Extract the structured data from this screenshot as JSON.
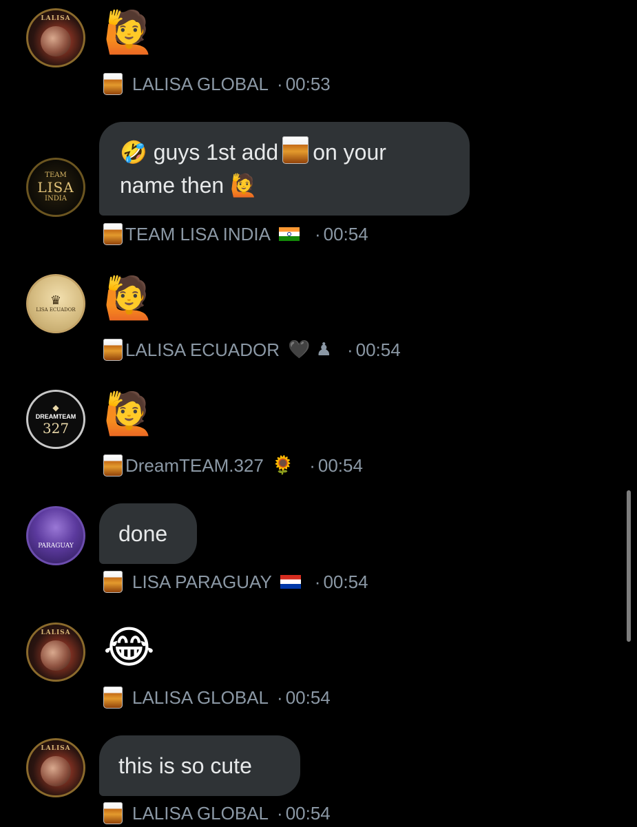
{
  "messages": [
    {
      "avatar": "lalisa-global-avatar",
      "avatar_text": "LALISA",
      "content_type": "emoji",
      "emoji": "🙋",
      "sender": "LALISA GLOBAL",
      "separator": "·",
      "time": "00:53"
    },
    {
      "avatar": "team-lisa-india-avatar",
      "avatar_lines": [
        "TEAM",
        "LISA",
        "INDIA"
      ],
      "content_type": "text",
      "text_parts": [
        "🤣 guys 1st add",
        "on your",
        "name then 🙋"
      ],
      "sender": "TEAM LISA INDIA",
      "flag": "🇮🇳",
      "separator": "·",
      "time": "00:54"
    },
    {
      "avatar": "lalisa-ecuador-avatar",
      "avatar_text": "LISA ECUADOR",
      "content_type": "emoji",
      "emoji": "🙋",
      "sender": "LALISA ECUADOR",
      "suffix_glyphs": "🖤 ♟",
      "separator": "·",
      "time": "00:54"
    },
    {
      "avatar": "dreamteam-327-avatar",
      "avatar_lines": [
        "DREAMTEAM",
        "327"
      ],
      "content_type": "emoji",
      "emoji": "🙋",
      "sender": "DreamTEAM.327",
      "suffix_glyphs": "🌻",
      "separator": "·",
      "time": "00:54"
    },
    {
      "avatar": "lisa-paraguay-avatar",
      "avatar_text": "PARAGUAY",
      "content_type": "text",
      "text": "done",
      "sender": "LISA PARAGUAY",
      "flag": "🇵🇾",
      "separator": "·",
      "time": "00:54"
    },
    {
      "avatar": "lalisa-global-avatar",
      "avatar_text": "LALISA",
      "content_type": "emoji",
      "emoji": "😂",
      "sender": "LALISA GLOBAL",
      "separator": "·",
      "time": "00:54"
    },
    {
      "avatar": "lalisa-global-avatar",
      "avatar_text": "LALISA",
      "content_type": "text",
      "text": "this is so cute",
      "sender": "LALISA GLOBAL",
      "separator": "·",
      "time": "00:54"
    }
  ],
  "colors": {
    "background": "#000000",
    "bubble": "#2f3336",
    "bubble_text": "#e7e9ea",
    "meta_text": "#8b98a5",
    "scrollbar": "#7d7d7d"
  }
}
